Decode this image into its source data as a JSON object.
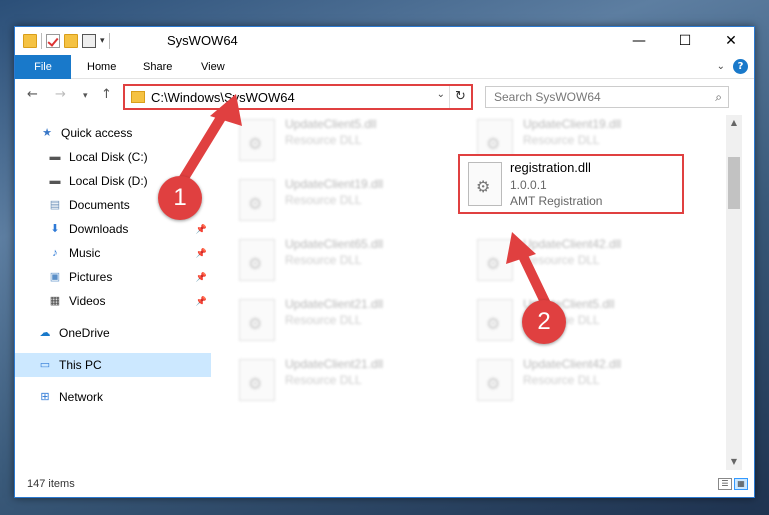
{
  "window": {
    "title": "SysWOW64",
    "controls": {
      "minimize": "—",
      "maximize": "☐",
      "close": "✕"
    }
  },
  "ribbon": {
    "tabs": [
      "File",
      "Home",
      "Share",
      "View"
    ]
  },
  "navigation": {
    "back": "←",
    "forward": "→",
    "recent": "▾",
    "up": "↑",
    "address": "C:\\Windows\\SysWOW64",
    "search_placeholder": "Search SysWOW64"
  },
  "sidebar": {
    "items": [
      {
        "label": "Quick access",
        "icon": "star-icon"
      },
      {
        "label": "Local Disk (C:)",
        "icon": "drive-icon"
      },
      {
        "label": "Local Disk (D:)",
        "icon": "drive-icon"
      },
      {
        "label": "Documents",
        "icon": "documents-icon"
      },
      {
        "label": "Downloads",
        "icon": "download-icon"
      },
      {
        "label": "Music",
        "icon": "music-icon"
      },
      {
        "label": "Pictures",
        "icon": "pictures-icon"
      },
      {
        "label": "Videos",
        "icon": "videos-icon"
      },
      {
        "label": "OneDrive",
        "icon": "cloud-icon"
      },
      {
        "label": "This PC",
        "icon": "computer-icon"
      },
      {
        "label": "Network",
        "icon": "network-icon"
      }
    ]
  },
  "files": [
    {
      "name": "UpdateClient5.dll",
      "desc": "Resource DLL"
    },
    {
      "name": "UpdateClient19.dll",
      "desc": "Resource DLL"
    },
    {
      "name": "UpdateClient19.dll",
      "desc": "Resource DLL"
    },
    {
      "name": "UpdateClient65.dll",
      "desc": "Resource DLL"
    },
    {
      "name": "UpdateClient42.dll",
      "desc": "Resource DLL"
    },
    {
      "name": "UpdateClient21.dll",
      "desc": "Resource DLL"
    },
    {
      "name": "UpdateClient5.dll",
      "desc": "Resource DLL"
    },
    {
      "name": "UpdateClient21.dll",
      "desc": "Resource DLL"
    },
    {
      "name": "UpdateClient42.dll",
      "desc": "Resource DLL"
    }
  ],
  "highlighted_file": {
    "name": "registration.dll",
    "version": "1.0.0.1",
    "description": "AMT Registration"
  },
  "status": {
    "item_count": "147 items"
  },
  "annotations": {
    "step1": "1",
    "step2": "2"
  },
  "colors": {
    "accent": "#1979ca",
    "highlight": "#e04040",
    "selected": "#cce8ff"
  }
}
